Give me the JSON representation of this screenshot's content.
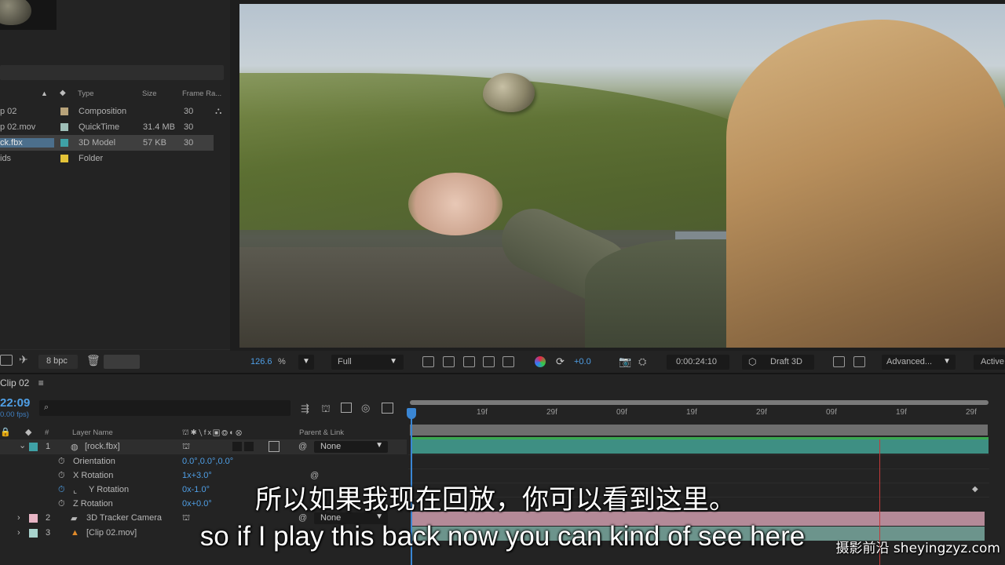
{
  "project": {
    "columns": {
      "type": "Type",
      "size": "Size",
      "frame_rate": "Frame Ra..."
    },
    "items": [
      {
        "name": "p 02",
        "type": "Composition",
        "size": "",
        "frame_rate": "30",
        "color": "#b8a37a"
      },
      {
        "name": "p 02.mov",
        "type": "QuickTime",
        "size": "31.4 MB",
        "frame_rate": "30",
        "color": "#9fbfb8"
      },
      {
        "name": "ck.fbx",
        "type": "3D Model",
        "size": "57 KB",
        "frame_rate": "30",
        "color": "#3fa1a6"
      },
      {
        "name": "ids",
        "type": "Folder",
        "size": "",
        "frame_rate": "",
        "color": "#e3c338"
      }
    ],
    "bpc": "8 bpc"
  },
  "viewer": {
    "zoom": "126.6",
    "zoom_unit": "%",
    "resolution": "Full",
    "exposure": "+0.0",
    "timecode": "0:00:24:10",
    "renderer": "Draft 3D",
    "view_mode": "Advanced...",
    "camera": "Active"
  },
  "timeline": {
    "comp_tab": "Clip 02",
    "current_time": "22:09",
    "fps": "0.00 fps)",
    "search_placeholder": "⌕",
    "header": {
      "num": "#",
      "layer_name": "Layer Name",
      "parent": "Parent & Link"
    },
    "ruler_labels": [
      "19f",
      "29f",
      "09f",
      "19f",
      "29f",
      "09f",
      "19f",
      "29f"
    ],
    "layers": [
      {
        "index": "1",
        "name": "[rock.fbx]",
        "parent": "None",
        "color": "#3fa1a6"
      },
      {
        "index": "2",
        "name": "3D Tracker Camera",
        "parent": "None",
        "color": "#e7b4c4"
      },
      {
        "index": "3",
        "name": "[Clip 02.mov]",
        "parent": "",
        "color": "#a8d3cd"
      }
    ],
    "properties": [
      {
        "name": "Orientation",
        "value": "0.0°,0.0°,0.0°"
      },
      {
        "name": "X Rotation",
        "value": "1x+3.0°"
      },
      {
        "name": "Y Rotation",
        "value": "0x-1.0°"
      },
      {
        "name": "Z Rotation",
        "value": "0x+0.0°"
      }
    ]
  },
  "subtitles": {
    "chinese": "所以如果我现在回放，你可以看到这里。",
    "english": "so if I play this back now you can kind of see here"
  },
  "watermark": "摄影前沿 sheyingzyz.com"
}
